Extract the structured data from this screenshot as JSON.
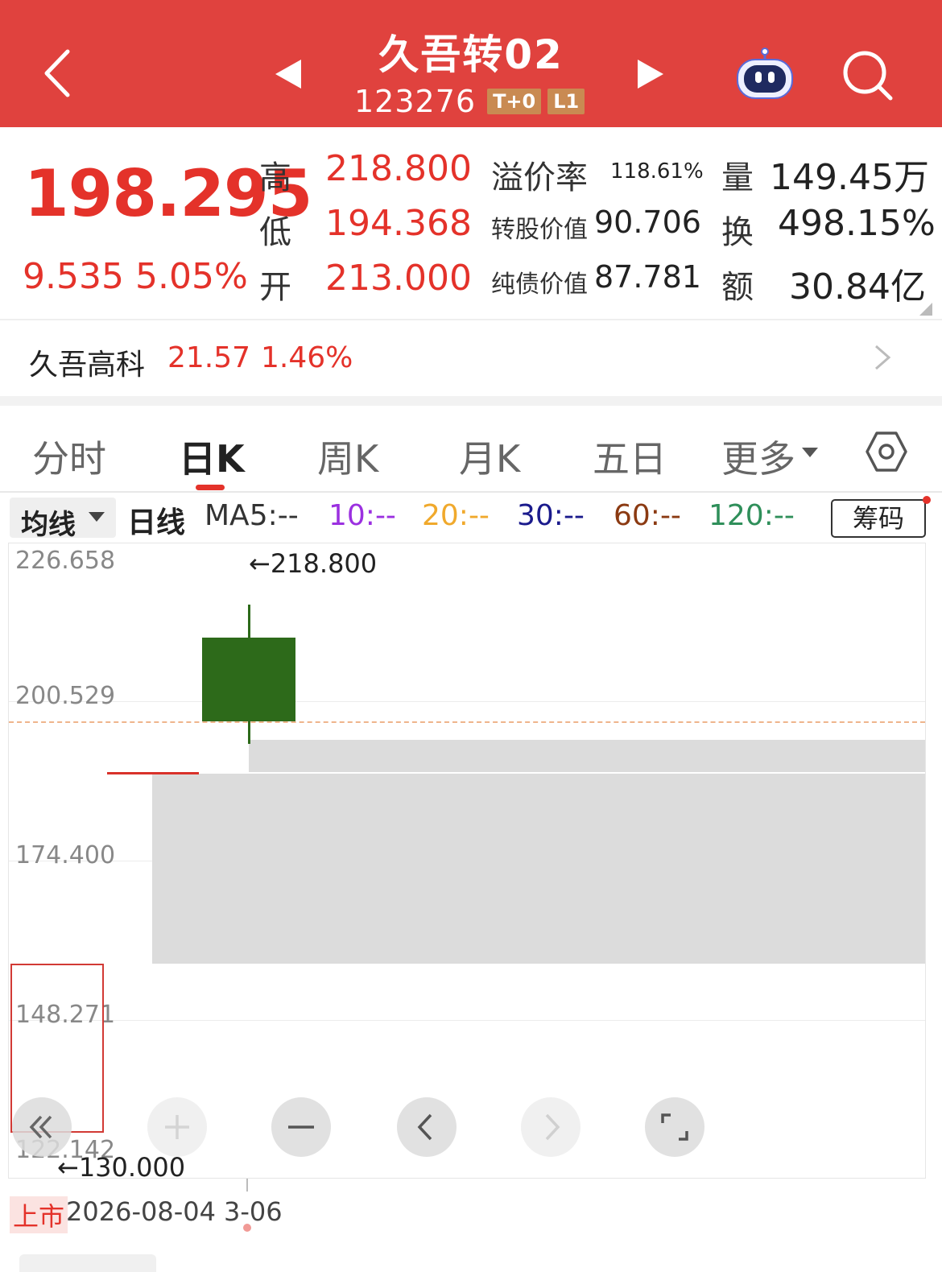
{
  "header": {
    "title": "久吾转02",
    "code": "123276",
    "tags": [
      "T+0",
      "L1"
    ],
    "bg_color": "#e0423e"
  },
  "quote": {
    "price": "198.295",
    "change": "9.535",
    "change_pct": "5.05%",
    "high_label": "高",
    "high": "218.800",
    "low_label": "低",
    "low": "194.368",
    "open_label": "开",
    "open": "213.000",
    "premium_label": "溢价率",
    "premium": "118.61%",
    "conv_value_label": "转股价值",
    "conv_value": "90.706",
    "bond_value_label": "纯债价值",
    "bond_value": "87.781",
    "volume_label": "量",
    "volume": "149.45万",
    "turnover_label": "换",
    "turnover": "498.15%",
    "amount_label": "额",
    "amount": "30.84亿",
    "up_color": "#e4322a"
  },
  "underlying": {
    "name": "久吾高科",
    "price": "21.57",
    "change_pct": "1.46%"
  },
  "tabs": [
    "分时",
    "日K",
    "周K",
    "月K",
    "五日",
    "更多"
  ],
  "active_tab": "日K",
  "ma": {
    "select_label": "均线",
    "period_label": "日线",
    "ma5": "MA5:--",
    "ma10": "10:--",
    "ma20": "20:--",
    "ma30": "30:--",
    "ma60": "60:--",
    "ma120": "120:--",
    "chip_label": "筹码",
    "colors": {
      "ma5": "#333333",
      "ma10": "#9b30e0",
      "ma20": "#f0a92c",
      "ma30": "#1a1a8c",
      "ma60": "#8b3a12",
      "ma120": "#2f8f5a"
    }
  },
  "chart": {
    "y_ticks": [
      "226.658",
      "200.529",
      "174.400",
      "148.271",
      "122.142"
    ],
    "high_annotation": "←218.800",
    "low_annotation": "←130.000"
  },
  "chart_data": {
    "type": "candlestick",
    "ylim": [
      122.142,
      226.658
    ],
    "y_ticks": [
      226.658,
      200.529,
      174.4,
      148.271,
      122.142
    ],
    "candles": [
      {
        "open": 213.0,
        "close": 198.295,
        "high": 218.8,
        "low": 194.368
      }
    ],
    "reference_price": 198.295,
    "high_mark": 218.8,
    "low_mark": 130.0
  },
  "footer": {
    "listing_tag": "上市",
    "date_start": "2026-08-04",
    "date_end": "3-06"
  }
}
